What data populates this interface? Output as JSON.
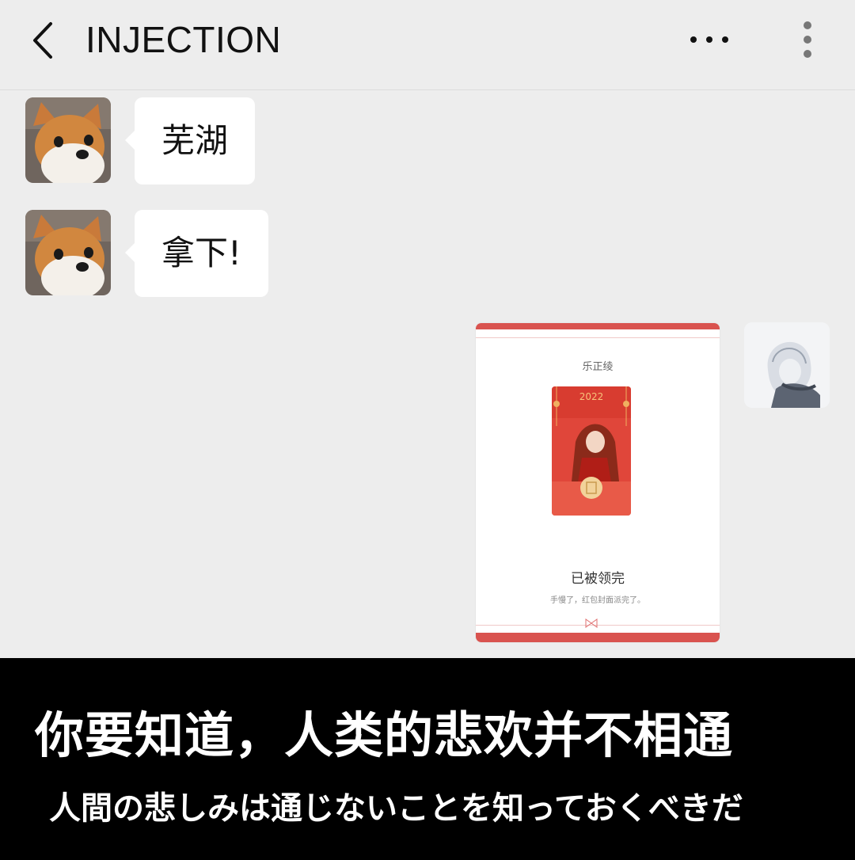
{
  "header": {
    "title": "INJECTION",
    "back_icon": "chevron-left-icon",
    "more_icon": "more-horizontal-icon",
    "menu_icon": "more-vertical-icon"
  },
  "messages": [
    {
      "sender": "corgi-avatar",
      "text": "芜湖"
    },
    {
      "sender": "corgi-avatar",
      "text": "拿下!"
    }
  ],
  "red_packet": {
    "sender_name": "乐正绫",
    "envelope_year": "2022",
    "status": "已被领完",
    "note": "手慢了，红包封面派完了。"
  },
  "subtitles": {
    "chinese": "你要知道，人类的悲欢并不相通",
    "japanese": "人間の悲しみは通じないことを知っておくべきだ"
  },
  "colors": {
    "background": "#ededed",
    "bubble": "#ffffff",
    "packet_red": "#d9534f",
    "subtitle_band": "#000000"
  }
}
